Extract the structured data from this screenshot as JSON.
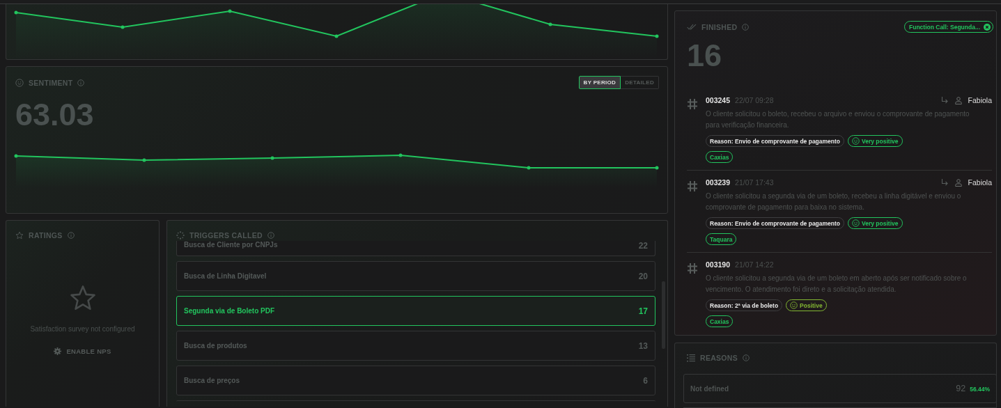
{
  "sentiment": {
    "title": "SENTIMENT",
    "value": "63.03",
    "view_toggle": [
      {
        "label": "BY PERIOD",
        "selected": true
      },
      {
        "label": "DETAILED",
        "selected": false
      }
    ]
  },
  "ratings": {
    "title": "RATINGS",
    "empty_message": "Satisfaction survey not configured",
    "action": "ENABLE NPS"
  },
  "triggers": {
    "title": "TRIGGERS CALLED",
    "items": [
      {
        "name": "Busca de Cliente por CNPJs",
        "count": "22",
        "selected": false
      },
      {
        "name": "Busca de Linha Digitavel",
        "count": "20",
        "selected": false
      },
      {
        "name": "Segunda via de Boleto PDF",
        "count": "17",
        "selected": true
      },
      {
        "name": "Busca de produtos",
        "count": "13",
        "selected": false
      },
      {
        "name": "Busca de preços",
        "count": "6",
        "selected": false
      }
    ]
  },
  "finished": {
    "title": "FINISHED",
    "filter_chip": "Function Call: Segunda...",
    "count": "16",
    "conversations": [
      {
        "id": "003245",
        "time": "22/07 09:28",
        "agent": "Fabiola",
        "summary": "O cliente solicitou o boleto, recebeu o arquivo e enviou o comprovante de pagamento para verificação financeira.",
        "reason": "Reason: Envio de comprovante de pagamento",
        "sentiment": {
          "label": "Very positive",
          "color": "#22c55e"
        },
        "tag": "Caxias"
      },
      {
        "id": "003239",
        "time": "21/07 17:43",
        "agent": "Fabiola",
        "summary": "O cliente solicitou a segunda via de um boleto, recebeu a linha digitável e enviou o comprovante de pagamento para baixa no sistema.",
        "reason": "Reason: Envio de comprovante de pagamento",
        "sentiment": {
          "label": "Very positive",
          "color": "#22c55e"
        },
        "tag": "Taquara"
      },
      {
        "id": "003190",
        "time": "21/07 14:22",
        "summary": "O cliente solicitou a segunda via de um boleto em aberto após ser notificado sobre o vencimento. O atendimento foi direto e a solicitação atendida.",
        "reason": "Reason: 2ª via de boleto",
        "sentiment": {
          "label": "Positive",
          "color": "#82b632"
        },
        "tag": "Caxias"
      }
    ]
  },
  "reasons": {
    "title": "REASONS",
    "items": [
      {
        "label": "Not defined",
        "count": "92",
        "percent": "56.44%"
      }
    ]
  }
}
